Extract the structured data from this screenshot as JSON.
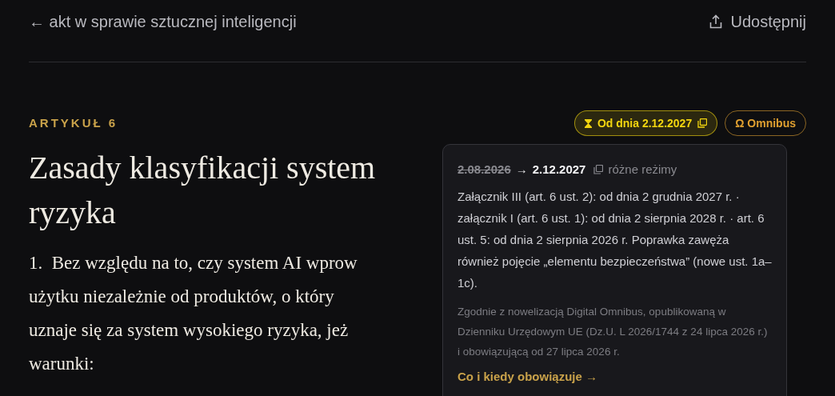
{
  "header": {
    "back_link": "← akt w sprawie sztucznej inteligencji",
    "share_button": "Udostępnij"
  },
  "article": {
    "label": "ARTYKUŁ 6",
    "badges": [
      {
        "kind": "date",
        "text": "Od dnia 2.12.2027",
        "color": "#f2d50f"
      },
      {
        "kind": "omnibus",
        "text": "Ω Omnibus",
        "color": "#e0a030"
      }
    ],
    "title_lines": [
      "Zasady klasyfikacji system",
      "ryzyka"
    ],
    "paragraph_lines": [
      "1.  Bez względu na to, czy system AI wprow",
      "użytku niezależnie od produktów, o który",
      "uznaje się za system wysokiego ryzyka, jeż",
      "warunki:"
    ]
  },
  "popover": {
    "old_date": "2.08.2026",
    "arrow": "→",
    "new_date": "2.12.2027",
    "regime": "różne reżimy",
    "body": "Załącznik III (art. 6 ust. 2): od dnia 2 grudnia 2027 r. · załącznik I (art. 6 ust. 1): od dnia 2 sierpnia 2028 r. · art. 6 ust. 5: od dnia 2 sierpnia 2026 r. Poprawka zawęża również pojęcie „elementu bezpieczeństwa” (nowe ust. 1a–1c).",
    "note": "Zgodnie z nowelizacją Digital Omnibus, opublikowaną w Dzienniku Urzędowym UE (Dz.U. L 2026/1744 z 24 lipca 2026 r.) i obowiązującą od 27 lipca 2026 r.",
    "link": "Co i kiedy obowiązuje →"
  }
}
